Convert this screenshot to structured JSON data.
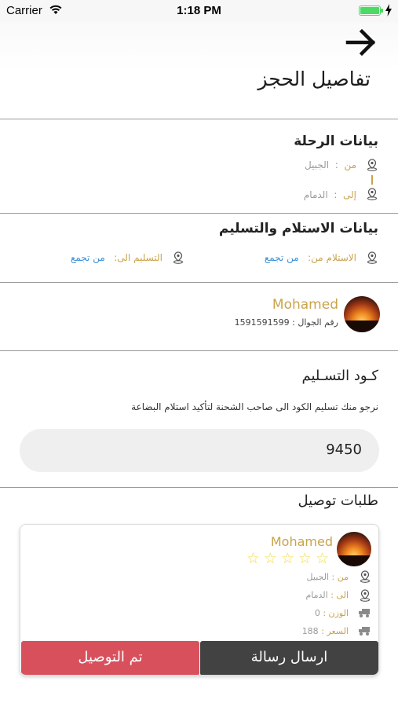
{
  "status_bar": {
    "carrier": "Carrier",
    "time": "1:18 PM"
  },
  "header": {
    "title": "تفاصيل الحجز",
    "back_icon": "arrow-right-icon"
  },
  "trip": {
    "title": "بيانات الرحلة",
    "from_label": "من",
    "from_value": "الجبيل",
    "to_label": "إلى",
    "to_value": "الدمام"
  },
  "delivery_info": {
    "title": "بيانات الاستلام والتسليم",
    "receive_label": "الاستلام من:",
    "receive_value": "من تجمع",
    "deliver_label": "التسليم الى:",
    "deliver_value": "من تجمع"
  },
  "customer": {
    "name": "Mohamed",
    "phone": "رقم الجوال : 1591591599"
  },
  "delivery_code": {
    "title": "كـود التسـليم",
    "hint": "نرجو منك تسليم الكود الى صاحب الشحنة لتأكيد استلام البضاعة",
    "value": "9450"
  },
  "requests": {
    "title": "طلبات توصيل",
    "card": {
      "name": "Mohamed",
      "stars": "☆☆☆☆☆",
      "from_label": "من :",
      "from_value": "الجبيل",
      "to_label": "الى :",
      "to_value": "الدمام",
      "weight_label": "الوزن :",
      "weight_value": "0",
      "price_label": "السعر :",
      "price_value": "188",
      "message_button": "ارسال رسالة",
      "delivered_button": "تم التوصيل"
    }
  },
  "colors": {
    "gold": "#c9a34b",
    "blue": "#3b8fd9",
    "dark_button": "#424242",
    "red_button": "#d9505d"
  }
}
